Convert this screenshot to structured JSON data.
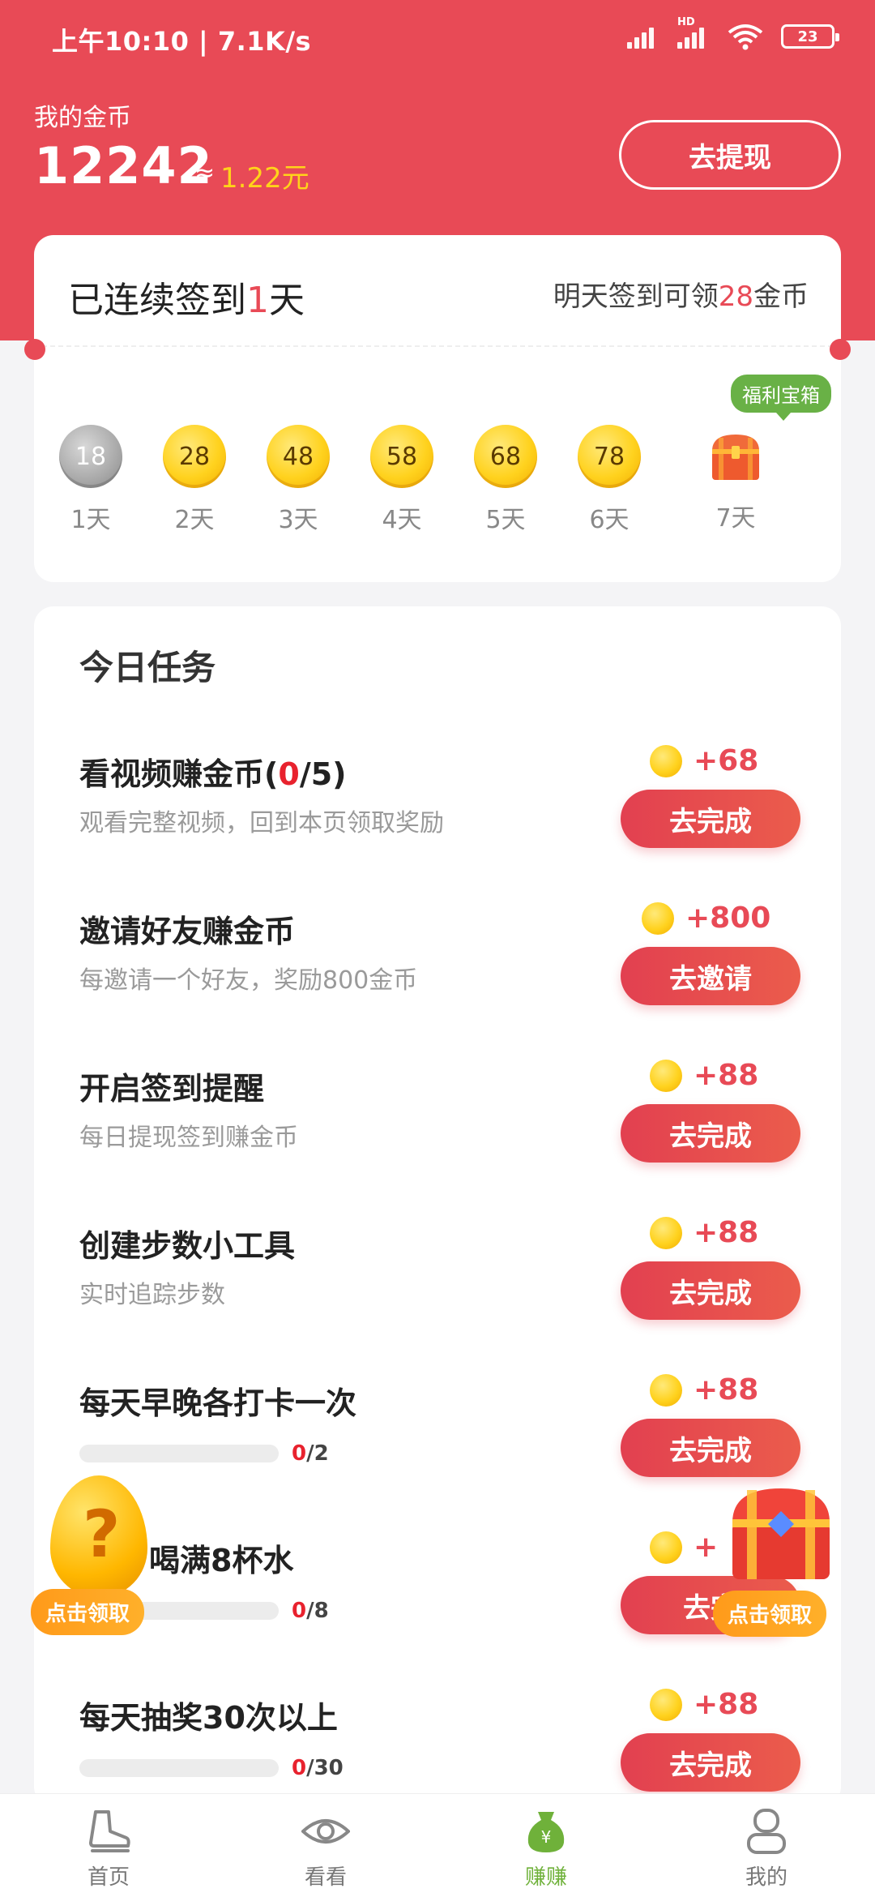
{
  "status_bar": {
    "time": "上午10:10 | 7.1K/s",
    "battery": "23",
    "hd": "HD"
  },
  "header": {
    "coin_label": "我的金币",
    "coin_amount": "12242",
    "approx": "≈",
    "yuan": "1.22元",
    "withdraw_label": "去提现",
    "bg_color": "#e84a56"
  },
  "signin": {
    "streak_prefix": "已连续签到",
    "streak_days": "1",
    "streak_suffix": "天",
    "tomorrow_prefix": "明天签到可领",
    "tomorrow_coins": "28",
    "tomorrow_suffix": "金币",
    "treasure_tag": "福利宝箱",
    "days": [
      {
        "value": "18",
        "label": "1天",
        "state": "claimed"
      },
      {
        "value": "28",
        "label": "2天"
      },
      {
        "value": "48",
        "label": "3天"
      },
      {
        "value": "58",
        "label": "4天"
      },
      {
        "value": "68",
        "label": "5天"
      },
      {
        "value": "78",
        "label": "6天"
      },
      {
        "value": "",
        "label": "7天",
        "icon": "treasure-chest-icon"
      }
    ]
  },
  "tasks": {
    "title": "今日任务",
    "items": [
      {
        "name": "看视频赚金币(",
        "progress_done": "0",
        "progress_rest": "/5)",
        "desc": "观看完整视频，回到本页领取奖励",
        "reward": "+68",
        "button": "去完成"
      },
      {
        "name": "邀请好友赚金币",
        "desc": "每邀请一个好友，奖励800金币",
        "reward": "+800",
        "button": "去邀请"
      },
      {
        "name": "开启签到提醒",
        "desc": "每日提现签到赚金币",
        "reward": "+88",
        "button": "去完成"
      },
      {
        "name": "创建步数小工具",
        "desc": "实时追踪步数",
        "reward": "+88",
        "button": "去完成"
      },
      {
        "name": "每天早晚各打卡一次",
        "progress_done": "0",
        "progress_total": "/2",
        "progress_fraction": 0,
        "reward": "+88",
        "button": "去完成"
      },
      {
        "name": "喝满8杯水",
        "progress_done": "0",
        "progress_total": "/8",
        "progress_fraction": 0,
        "reward": "+",
        "button": "去完"
      },
      {
        "name": "每天抽奖30次以上",
        "progress_done": "0",
        "progress_total": "/30",
        "progress_fraction": 0,
        "reward": "+88",
        "button": "去完成"
      }
    ]
  },
  "floating": {
    "egg_label": "点击领取",
    "chest_label": "点击领取"
  },
  "bottom_nav": {
    "items": [
      {
        "label": "首页",
        "icon": "sneaker-icon"
      },
      {
        "label": "看看",
        "icon": "eye-icon"
      },
      {
        "label": "赚赚",
        "icon": "money-bag-icon",
        "active": true
      },
      {
        "label": "我的",
        "icon": "profile-icon"
      }
    ],
    "active_color": "#6fb13a"
  }
}
